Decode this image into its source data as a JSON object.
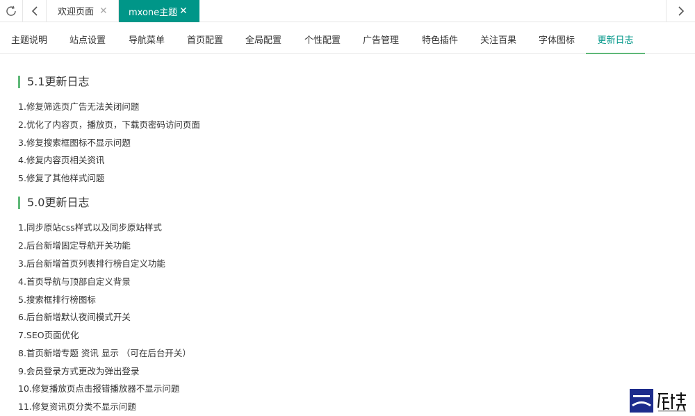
{
  "tabs": {
    "tab1_label": "欢迎页面",
    "tab2_label": "mxone主题",
    "close_glyph": "✕"
  },
  "subnav": {
    "items": [
      "主题说明",
      "站点设置",
      "导航菜单",
      "首页配置",
      "全局配置",
      "个性配置",
      "广告管理",
      "特色插件",
      "关注百果",
      "字体图标",
      "更新日志"
    ],
    "active_index": 10
  },
  "sections": [
    {
      "title": "5.1更新日志",
      "lines": [
        "1.修复筛选页广告无法关闭问题",
        "2.优化了内容页，播放页，下载页密码访问页面",
        "3.修复搜索框图标不显示问题",
        "4.修复内容页相关资讯",
        "5.修复了其他样式问题"
      ]
    },
    {
      "title": "5.0更新日志",
      "lines": [
        "1.同步原站css样式以及同步原站样式",
        "2.后台新增固定导航开关功能",
        "3.后台新增首页列表排行榜自定义功能",
        "4.首页导航与顶部自定义背景",
        "5.搜索框排行榜图标",
        "6.后台新增默认夜间模式开关",
        "7.SEO页面优化",
        "8.首页新增专题 资讯 显示 （可在后台开关）",
        "9.会员登录方式更改为弹出登录",
        "10.修复播放页点击报错播放器不显示问题",
        "11.修复资讯页分类不显示问题"
      ]
    }
  ],
  "colors": {
    "accent": "#009688",
    "accent_light": "#5fb878",
    "border": "#e6e6e6"
  },
  "icons": [
    "refresh-icon",
    "chevron-left-icon",
    "chevron-right-icon",
    "close-icon",
    "logo-icon"
  ]
}
